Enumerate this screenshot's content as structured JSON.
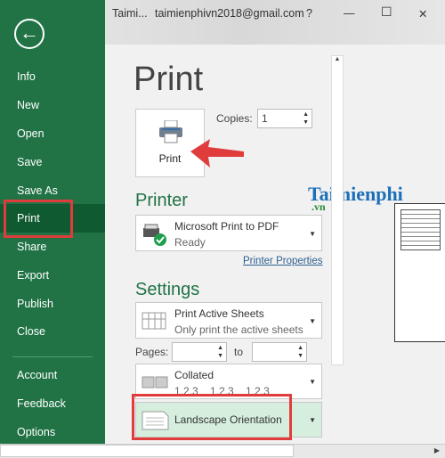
{
  "sidebar": {
    "items": [
      {
        "label": "Info"
      },
      {
        "label": "New"
      },
      {
        "label": "Open"
      },
      {
        "label": "Save"
      },
      {
        "label": "Save As"
      },
      {
        "label": "Print"
      },
      {
        "label": "Share"
      },
      {
        "label": "Export"
      },
      {
        "label": "Publish"
      },
      {
        "label": "Close"
      },
      {
        "label": "Account"
      },
      {
        "label": "Feedback"
      },
      {
        "label": "Options"
      }
    ],
    "selected": "Print",
    "accent": "#217346"
  },
  "titlebar": {
    "doc": "Taimi...",
    "account": "taimienphivn2018@gmail.com",
    "help": "?",
    "min": "—",
    "max": "☐",
    "close": "✕"
  },
  "main": {
    "title": "Print",
    "print_button": "Print",
    "copies_label": "Copies:",
    "copies_value": "1",
    "printer_heading": "Printer",
    "printer_name": "Microsoft Print to PDF",
    "printer_status": "Ready",
    "printer_properties": "Printer Properties",
    "settings_heading": "Settings",
    "sheets_title": "Print Active Sheets",
    "sheets_sub": "Only print the active sheets",
    "pages_label": "Pages:",
    "pages_to": "to",
    "pages_from_value": "",
    "pages_to_value": "",
    "collated_title": "Collated",
    "collated_sub": "1,2,3    1,2,3    1,2,3",
    "orientation": "Landscape Orientation"
  },
  "watermark": {
    "text": "Taimienphi",
    "sub": ".vn"
  },
  "highlight_color": "#e03c3c"
}
